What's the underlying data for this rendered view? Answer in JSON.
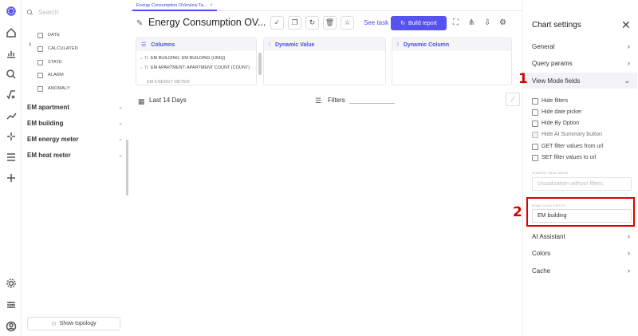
{
  "left_panel": {
    "search_placeholder": "Search",
    "tree_items": [
      "DATE",
      "CALCULATED",
      "STATE",
      "ALARM",
      "ANOMALY"
    ],
    "groups": [
      "EM apartment",
      "EM building",
      "EM energy meter",
      "EM heat meter"
    ],
    "show_topology": "Show topology"
  },
  "tab": {
    "label": "Energy Consumption OVerview Ta...",
    "close": "×"
  },
  "title": "Energy Consumption OV...",
  "see_task": "See task",
  "build_report": "Build report",
  "columns_panel": {
    "header": "Columns",
    "rows": [
      "EM BUILDING: EM BUILDING (UNIQ)",
      "EM APARTMENT: APARTMENT COUNT (COUNT)",
      "EM ENERGY METER"
    ]
  },
  "dynamic_value_header": "Dynamic Value",
  "dynamic_column_header": "Dynamic Column",
  "date_range": "Last 14 Days",
  "filters_label": "Filters",
  "chart_settings": {
    "title": "Chart settings",
    "sections": [
      "General",
      "Query params",
      "View Mode fields"
    ],
    "checkboxes": [
      {
        "label": "Hide filters",
        "disabled": false
      },
      {
        "label": "Hide date picker",
        "disabled": false
      },
      {
        "label": "Hide By Option",
        "disabled": false
      },
      {
        "label": "Hide AI Summary button",
        "disabled": true
      },
      {
        "label": "GET filter values from url",
        "disabled": false
      },
      {
        "label": "SET filter values to url",
        "disabled": false
      }
    ],
    "mode_label": "SHARED VIEW MODE",
    "mode_placeholder": "Visualization without filters",
    "row_click_label": "ROW CLICK ENTITY",
    "row_click_value": "EM building",
    "bottom_sections": [
      "AI Assistant",
      "Colors",
      "Cache"
    ]
  },
  "annotations": {
    "step1": "1",
    "step2": "2",
    "highlight_color": "#e00000"
  },
  "colors": {
    "accent": "#5652f0"
  }
}
